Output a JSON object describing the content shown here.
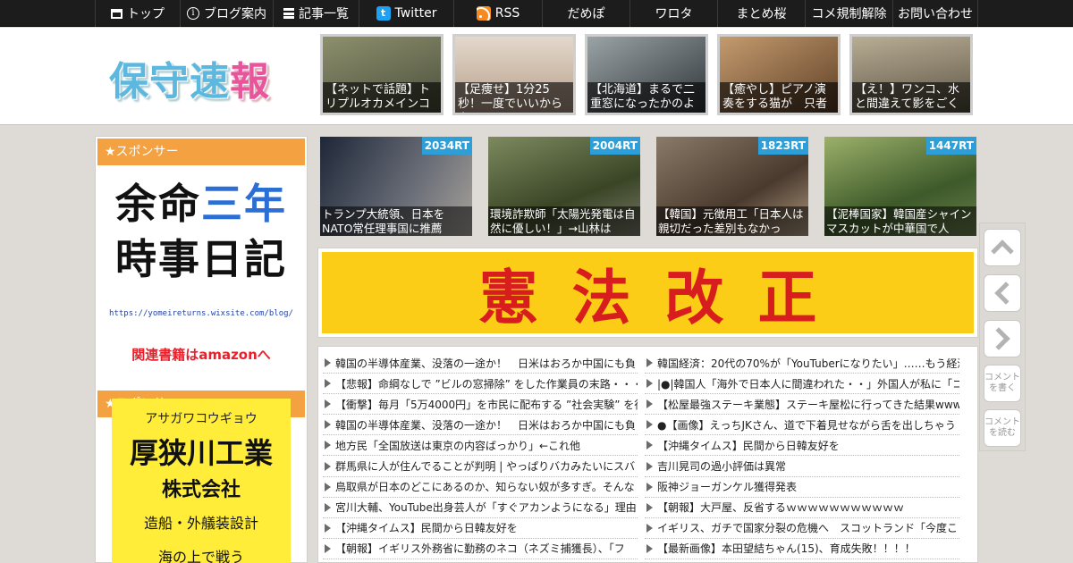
{
  "nav": {
    "items": [
      {
        "label": "トップ"
      },
      {
        "label": "ブログ案内"
      },
      {
        "label": "記事一覧"
      },
      {
        "label": "Twitter"
      },
      {
        "label": "RSS"
      },
      {
        "label": "だめぽ"
      },
      {
        "label": "ワロタ"
      },
      {
        "label": "まとめ桜"
      },
      {
        "label": "コメ規制解除"
      },
      {
        "label": "お問い合わせ"
      }
    ]
  },
  "logo": {
    "part1": "保守速",
    "part2": "報"
  },
  "header_thumbs": [
    {
      "caption": "【ネットで話題】トリプルオカメインコ",
      "bg": "#6b6f5a"
    },
    {
      "caption": "【足痩せ】1分25秒！一度でいいからやっ",
      "bg": "#cbb8a6"
    },
    {
      "caption": "【北海道】まるで二重窓になったかのよ",
      "bg": "#5f6668"
    },
    {
      "caption": "【癒やし】ピアノ演奏をする猫が　只者",
      "bg": "#9a6e4a"
    },
    {
      "caption": "【え！】ワンコ、水と間違えて影をごく",
      "bg": "#8a8270"
    }
  ],
  "sidebar": {
    "sponsor_label_1": "★スポンサー",
    "sponsor_label_2": "★スポンサー",
    "ad1": {
      "line1_a": "余命",
      "line1_b": "三年",
      "line2": "時事日記",
      "url": "https://yomeireturns.wixsite.com/blog/",
      "amazon": "関連書籍はamazonへ"
    },
    "ad2": {
      "kana": "アサガワコウギョウ",
      "name": "厚狭川工業",
      "corp": "株式会社",
      "service": "造船・外艤装設計",
      "extra": "海の上で戦う"
    }
  },
  "rt_thumbs": [
    {
      "count": "2034RT",
      "caption": "トランプ大統領、日本をNATO常任理事国に推薦",
      "bg": "#2c3140"
    },
    {
      "count": "2004RT",
      "caption": "環境詐欺師「太陽光発電は自然に優しい！」→山林は",
      "bg": "#4f5a3a"
    },
    {
      "count": "1823RT",
      "caption": "【韓国】元徴用工「日本人は親切だった差別もなかっ",
      "bg": "#6a5a4a"
    },
    {
      "count": "1447RT",
      "caption": "【泥棒国家】韓国産シャインマスカットが中華国で人",
      "bg": "#4d6a3a"
    }
  ],
  "banner": {
    "text": "憲法改正"
  },
  "articles_left": [
    "韓国の半導体産業、没落の一途か！　日米はおろか中国にも負",
    "【悲報】命綱なしで ”ビルの窓掃除” をした作業員の末路・・・",
    "【衝撃】毎月「5万4000円」を市民に配布する ”社会実験” を行",
    "韓国の半導体産業、没落の一途か！　日米はおろか中国にも負",
    "地方民「全国放送は東京の内容ばっかり」←これ他",
    "群馬県に人が住んでることが判明 | やっぱりバカみたいにスバ",
    "鳥取県が日本のどこにあるのか、知らない奴が多すぎ。そんな",
    "宮川大輔、YouTube出身芸人が「すぐアカンようになる」理由を",
    "【沖縄タイムス】民間から日韓友好を",
    "【朝報】イギリス外務省に勤務のネコ（ネズミ捕獲長）、「フ"
  ],
  "articles_right": [
    "韓国経済：20代の70%が「YouTuberになりたい」……もう経済",
    "|●|韓国人「海外で日本人に間違われた・・」外国人が私に「コン",
    "【松屋最強ステーキ業態】ステーキ屋松に行ってきた結果www",
    "●【画像】えっちJKさん、道で下着見せながら舌を出しちゃう",
    "【沖縄タイムス】民間から日韓友好を",
    "吉川晃司の過小評価は異常",
    "阪神ジョーガンケル獲得発表",
    "【朝報】大戸屋、反省するｗｗｗｗｗｗｗｗｗｗｗ",
    "イギリス、ガチで国家分裂の危機へ　スコットランド「今度こ",
    "【最新画像】本田望結ちゃん(15)、育成失敗！！！！"
  ],
  "side_buttons": {
    "comment_write": "コメントを書く",
    "comment_read": "コメントを読む"
  },
  "colors": {
    "nav_bg": "#1c1c1c",
    "sponsor_orange": "#f4a142",
    "rt_badge": "#2d9fd8",
    "banner_yellow": "#fccd17",
    "banner_red": "#d71d1d"
  }
}
